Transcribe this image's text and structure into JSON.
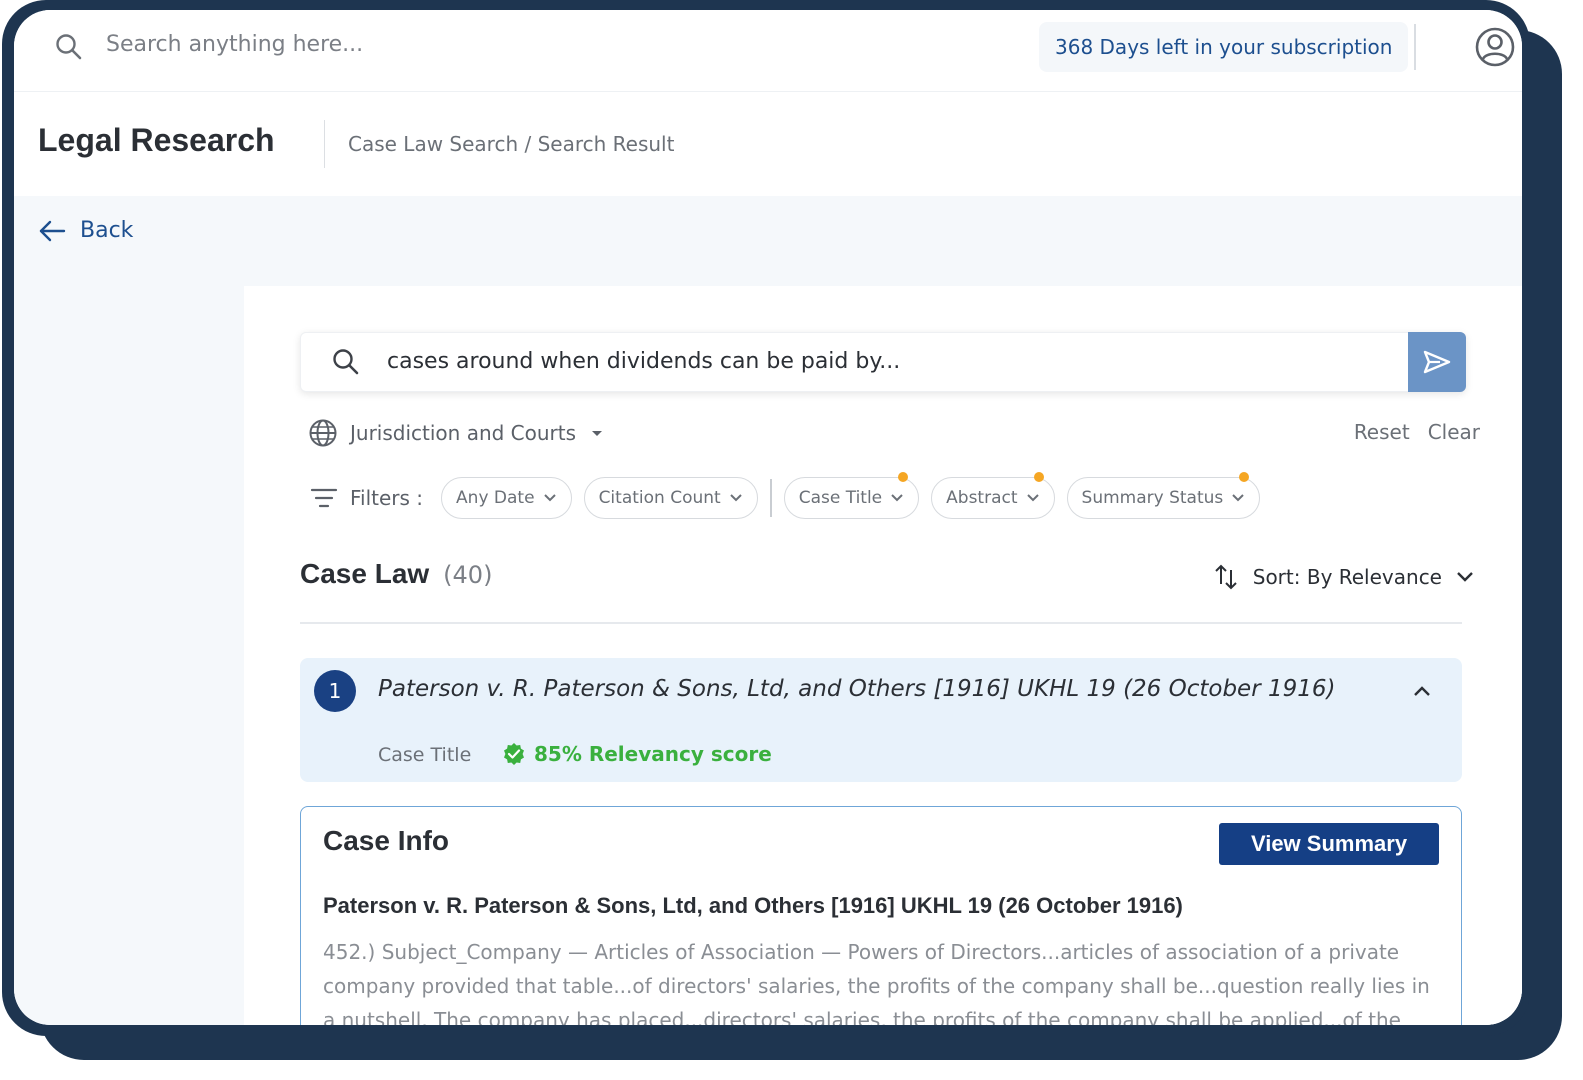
{
  "topbar": {
    "search_placeholder": "Search anything here...",
    "subscription": "368 Days left in your subscription"
  },
  "header": {
    "title": "Legal Research",
    "breadcrumb": "Case Law Search / Search Result"
  },
  "nav": {
    "back_label": "Back"
  },
  "query": {
    "text": "cases around when dividends can be paid by..."
  },
  "jurisdiction": {
    "label": "Jurisdiction and Courts"
  },
  "actions": {
    "reset": "Reset",
    "clear": "Clear"
  },
  "filters": {
    "label": "Filters :",
    "chips": [
      {
        "label": "Any Date",
        "dot": false
      },
      {
        "label": "Citation Count",
        "dot": false
      },
      {
        "label": "Case Title",
        "dot": true
      },
      {
        "label": "Abstract",
        "dot": true
      },
      {
        "label": "Summary Status",
        "dot": true
      }
    ]
  },
  "results": {
    "heading": "Case Law",
    "count": "(40)",
    "sort_label": "Sort: By Relevance",
    "items": [
      {
        "number": "1",
        "title": "Paterson v. R. Paterson & Sons, Ltd, and Others [1916] UKHL 19 (26 October 1916)",
        "match_label": "Case Title",
        "relevancy": "85% Relevancy score"
      }
    ]
  },
  "case_info": {
    "heading": "Case Info",
    "view_button": "View Summary",
    "case_title": "Paterson v. R. Paterson & Sons, Ltd, and Others [1916] UKHL 19 (26 October 1916)",
    "abstract": "452.) Subject_Company — Articles of Association — Powers of Directors...articles of association of a private company provided that table...of directors' salaries, the profits of the company shall be...question really lies in a nutshell. The company has placed...directors' salaries, the profits of the company shall be applied...of the"
  },
  "colors": {
    "frame": "#1e3550",
    "primary": "#153f85",
    "accent_link": "#1d4f8f",
    "send_button": "#6b94c6",
    "result_bg": "#e8f2fb",
    "relevancy_green": "#3ab03e",
    "filter_dot": "#f5a623"
  },
  "icons": {
    "search": "search-icon",
    "user": "user-circle-icon",
    "back": "arrow-left-icon",
    "send": "send-icon",
    "globe": "globe-icon",
    "filter": "filter-icon",
    "sort": "sort-arrows-icon",
    "verified": "verified-badge-icon"
  }
}
